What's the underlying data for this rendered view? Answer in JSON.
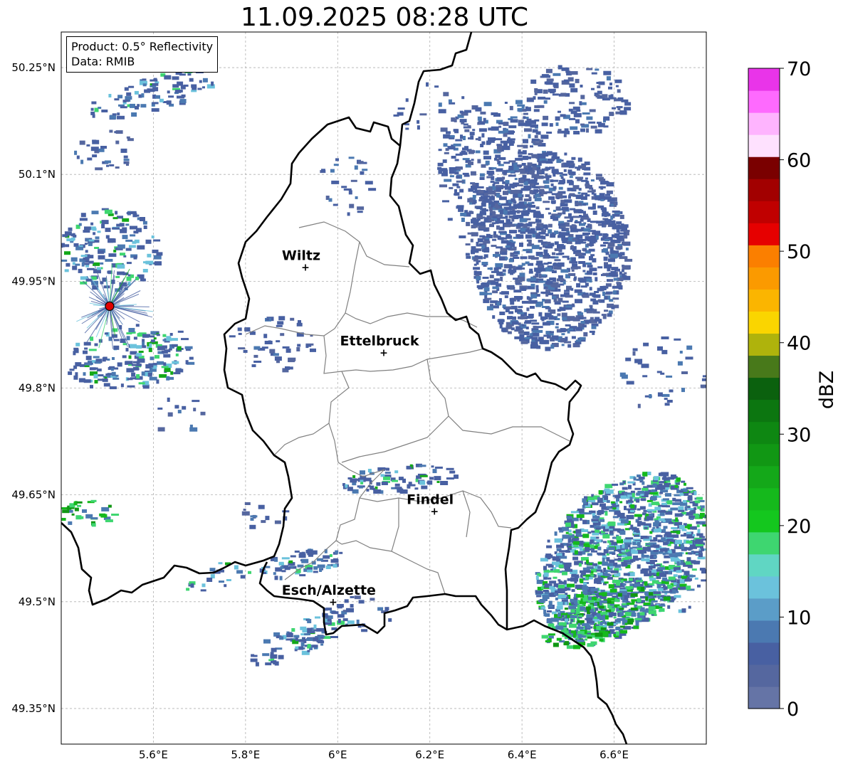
{
  "title": "11.09.2025 08:28 UTC",
  "info": {
    "product": "Product: 0.5° Reflectivity",
    "data": "Data: RMIB"
  },
  "map": {
    "lon_range": [
      5.4,
      6.8
    ],
    "lat_range": [
      49.3,
      50.3
    ],
    "lon_ticks": [
      {
        "value": 5.6,
        "label": "5.6°E"
      },
      {
        "value": 5.8,
        "label": "5.8°E"
      },
      {
        "value": 6.0,
        "label": "6°E"
      },
      {
        "value": 6.2,
        "label": "6.2°E"
      },
      {
        "value": 6.4,
        "label": "6.4°E"
      },
      {
        "value": 6.6,
        "label": "6.6°E"
      }
    ],
    "lat_ticks": [
      {
        "value": 49.35,
        "label": "49.35°N"
      },
      {
        "value": 49.5,
        "label": "49.5°N"
      },
      {
        "value": 49.65,
        "label": "49.65°N"
      },
      {
        "value": 49.8,
        "label": "49.8°N"
      },
      {
        "value": 49.95,
        "label": "49.95°N"
      },
      {
        "value": 50.1,
        "label": "50.1°N"
      },
      {
        "value": 50.25,
        "label": "50.25°N"
      }
    ],
    "cities": [
      {
        "name": "Wiltz",
        "lon": 5.93,
        "lat": 49.97
      },
      {
        "name": "Ettelbruck",
        "lon": 6.1,
        "lat": 49.85
      },
      {
        "name": "Findel",
        "lon": 6.21,
        "lat": 49.627
      },
      {
        "name": "Esch/Alzette",
        "lon": 5.99,
        "lat": 49.5
      }
    ],
    "radar_site": {
      "lon": 5.505,
      "lat": 49.915
    }
  },
  "colorbar": {
    "unit": "dBZ",
    "min": 0,
    "max": 70,
    "ticks": [
      0,
      10,
      20,
      30,
      40,
      50,
      60,
      70
    ],
    "colors": [
      "#6574a6",
      "#55679f",
      "#4860a2",
      "#4b79b1",
      "#5b9dc8",
      "#6bc2dc",
      "#60d6c3",
      "#3ed670",
      "#14c71e",
      "#15b91c",
      "#14a819",
      "#119714",
      "#0e8712",
      "#0c7610",
      "#0b610e",
      "#48791a",
      "#afb30c",
      "#fad500",
      "#fbb500",
      "#fb9a00",
      "#fb7f00",
      "#e60000",
      "#c00000",
      "#a20000",
      "#7a0000",
      "#fee1fe",
      "#feb4fe",
      "#fe6afe",
      "#e934e9"
    ]
  }
}
